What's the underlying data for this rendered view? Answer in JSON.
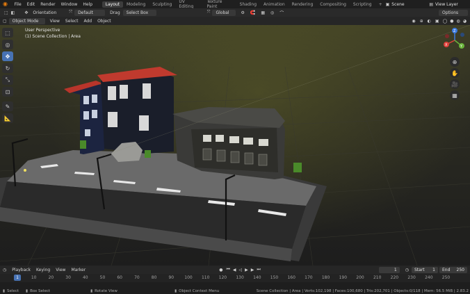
{
  "menu": [
    "File",
    "Edit",
    "Render",
    "Window",
    "Help"
  ],
  "workspaces": [
    "Layout",
    "Modeling",
    "Sculpting",
    "UV Editing",
    "Texture Paint",
    "Shading",
    "Animation",
    "Rendering",
    "Compositing",
    "Scripting"
  ],
  "active_workspace": "Layout",
  "add_workspace": "+",
  "scene": "Scene",
  "view_layer": "View Layer",
  "tool_settings": {
    "orientation_label": "Orientation",
    "orientation_value": "Default",
    "drag_label": "Drag",
    "drag_value": "Select Box",
    "transform_orientation": "Global",
    "options": "Options"
  },
  "viewport_header": {
    "mode": "Object Mode",
    "menus": [
      "View",
      "Select",
      "Add",
      "Object"
    ]
  },
  "viewport": {
    "perspective": "User Perspective",
    "collection": "(1) Scene Collection | Area"
  },
  "gizmo_axes": {
    "z": "Z",
    "x": "X",
    "y": "Y"
  },
  "timeline": {
    "menus": [
      "Playback",
      "Keying",
      "View",
      "Marker"
    ],
    "current_frame": "1",
    "start_label": "Start",
    "start": "1",
    "end_label": "End",
    "end": "250",
    "ticks": [
      "1",
      "10",
      "20",
      "30",
      "40",
      "50",
      "60",
      "70",
      "80",
      "90",
      "100",
      "110",
      "120",
      "130",
      "140",
      "150",
      "160",
      "170",
      "180",
      "190",
      "200",
      "210",
      "220",
      "230",
      "240",
      "250"
    ]
  },
  "status_bar": {
    "select": "Select",
    "box_select": "Box Select",
    "rotate_view": "Rotate View",
    "context_menu": "Object Context Menu",
    "stats": "Scene Collection | Area | Verts:102,198 | Faces:100,680 | Tris:202,701 | Objects:0/118 | Mem: 56.5 MiB | 2.83.2"
  },
  "colors": {
    "accent": "#4772b3",
    "roof": "#c0392b",
    "building_blue": "#1e2a4a",
    "road": "#2b2b2b",
    "sidewalk": "#5a5a5a",
    "bin": "#4a8a2a"
  }
}
